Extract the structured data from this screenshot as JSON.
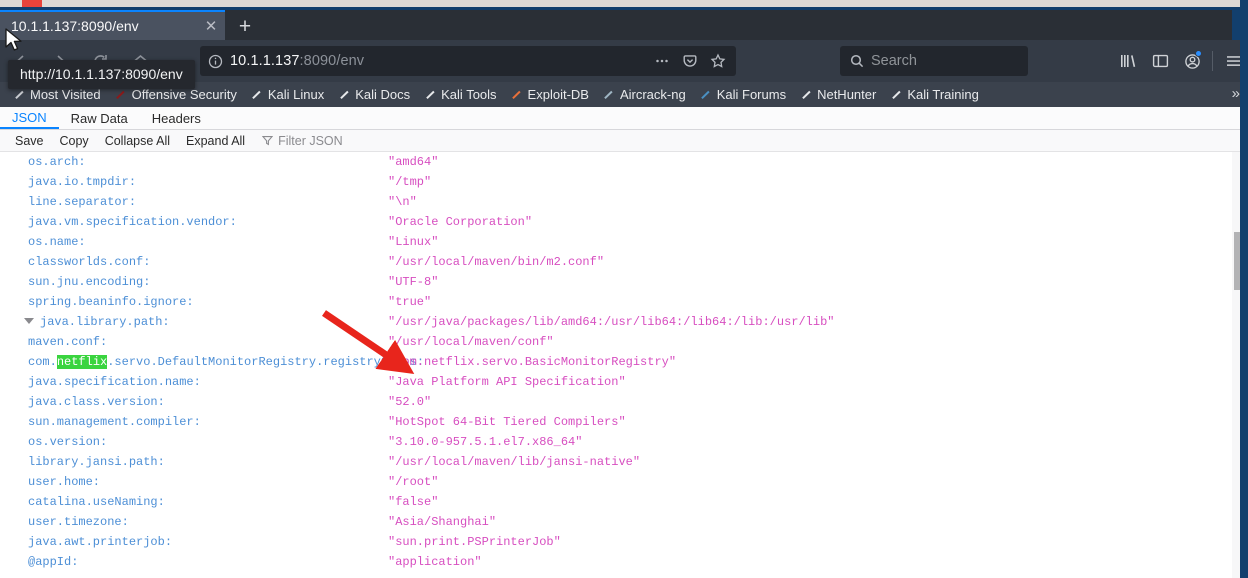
{
  "window": {
    "tab": {
      "title": "10.1.1.137:8090/env",
      "close_label": "✕",
      "newtab_label": "+"
    }
  },
  "navbar": {
    "back_icon": "back-arrow-icon",
    "forward_icon": "forward-arrow-icon",
    "reload_icon": "reload-icon",
    "home_icon": "home-icon",
    "url": {
      "host": "10.1.1.137",
      "path": ":8090/env",
      "identity_icon": "info-icon",
      "page_actions_icon": "ellipsis-icon",
      "pocket_icon": "pocket-icon",
      "bookmark_icon": "star-icon"
    },
    "search": {
      "placeholder": "Search",
      "icon": "search-icon"
    },
    "tools": {
      "library_icon": "library-icon",
      "sidebar_icon": "sidebar-icon",
      "account_icon": "account-icon",
      "menu_icon": "hamburger-menu-icon"
    }
  },
  "tooltip": {
    "text": "http://10.1.1.137:8090/env"
  },
  "bookmarks": {
    "overflow_label": "»",
    "items": [
      {
        "label": "Most Visited",
        "favicon": "grid-icon",
        "color": "#c9ccd1"
      },
      {
        "label": "Offensive Security",
        "favicon": "offsec-icon",
        "color": "#8b1a1a"
      },
      {
        "label": "Kali Linux",
        "favicon": "dragon-icon",
        "color": "#e6e8ea"
      },
      {
        "label": "Kali Docs",
        "favicon": "dragon-icon",
        "color": "#e6e8ea"
      },
      {
        "label": "Kali Tools",
        "favicon": "dragon-icon",
        "color": "#e6e8ea"
      },
      {
        "label": "Exploit-DB",
        "favicon": "exploitdb-icon",
        "color": "#e8703a"
      },
      {
        "label": "Aircrack-ng",
        "favicon": "aircrack-icon",
        "color": "#9fb6c4"
      },
      {
        "label": "Kali Forums",
        "favicon": "forums-icon",
        "color": "#4a90c2"
      },
      {
        "label": "NetHunter",
        "favicon": "dragon-icon",
        "color": "#e6e8ea"
      },
      {
        "label": "Kali Training",
        "favicon": "dragon-icon",
        "color": "#e6e8ea"
      }
    ]
  },
  "json_viewer": {
    "tabs": [
      {
        "label": "JSON",
        "active": true
      },
      {
        "label": "Raw Data",
        "active": false
      },
      {
        "label": "Headers",
        "active": false
      }
    ],
    "toolbar": {
      "save": "Save",
      "copy": "Copy",
      "collapse_all": "Collapse All",
      "expand_all": "Expand All",
      "filter_placeholder": "Filter JSON",
      "filter_icon": "funnel-icon"
    },
    "rows": [
      {
        "key": "os.arch:",
        "value": "\"amd64\""
      },
      {
        "key": "java.io.tmpdir:",
        "value": "\"/tmp\""
      },
      {
        "key": "line.separator:",
        "value": "\"\\n\""
      },
      {
        "key": "java.vm.specification.vendor:",
        "value": "\"Oracle Corporation\""
      },
      {
        "key": "os.name:",
        "value": "\"Linux\""
      },
      {
        "key": "classworlds.conf:",
        "value": "\"/usr/local/maven/bin/m2.conf\""
      },
      {
        "key": "sun.jnu.encoding:",
        "value": "\"UTF-8\""
      },
      {
        "key": "spring.beaninfo.ignore:",
        "value": "\"true\""
      },
      {
        "key": "java.library.path:",
        "value": "\"/usr/java/packages/lib/amd64:/usr/lib64:/lib64:/lib:/usr/lib\"",
        "expandable": true
      },
      {
        "key": "maven.conf:",
        "value": "\"/usr/local/maven/conf\""
      },
      {
        "key": "com.netflix.servo.DefaultMonitorRegistry.registryClass:",
        "value": "\"com.netflix.servo.BasicMonitorRegistry\"",
        "highlight": "netflix"
      },
      {
        "key": "java.specification.name:",
        "value": "\"Java Platform API Specification\""
      },
      {
        "key": "java.class.version:",
        "value": "\"52.0\""
      },
      {
        "key": "sun.management.compiler:",
        "value": "\"HotSpot 64-Bit Tiered Compilers\""
      },
      {
        "key": "os.version:",
        "value": "\"3.10.0-957.5.1.el7.x86_64\""
      },
      {
        "key": "library.jansi.path:",
        "value": "\"/usr/local/maven/lib/jansi-native\""
      },
      {
        "key": "user.home:",
        "value": "\"/root\""
      },
      {
        "key": "catalina.useNaming:",
        "value": "\"false\""
      },
      {
        "key": "user.timezone:",
        "value": "\"Asia/Shanghai\""
      },
      {
        "key": "java.awt.printerjob:",
        "value": "\"sun.print.PSPrinterJob\""
      },
      {
        "key": "@appId:",
        "value": "\"application\""
      }
    ],
    "highlight_color": "#3ad43f",
    "key_color": "#4d8fd6",
    "value_color": "#d74ec0"
  },
  "annotation": {
    "arrow_color": "#e8251c"
  }
}
